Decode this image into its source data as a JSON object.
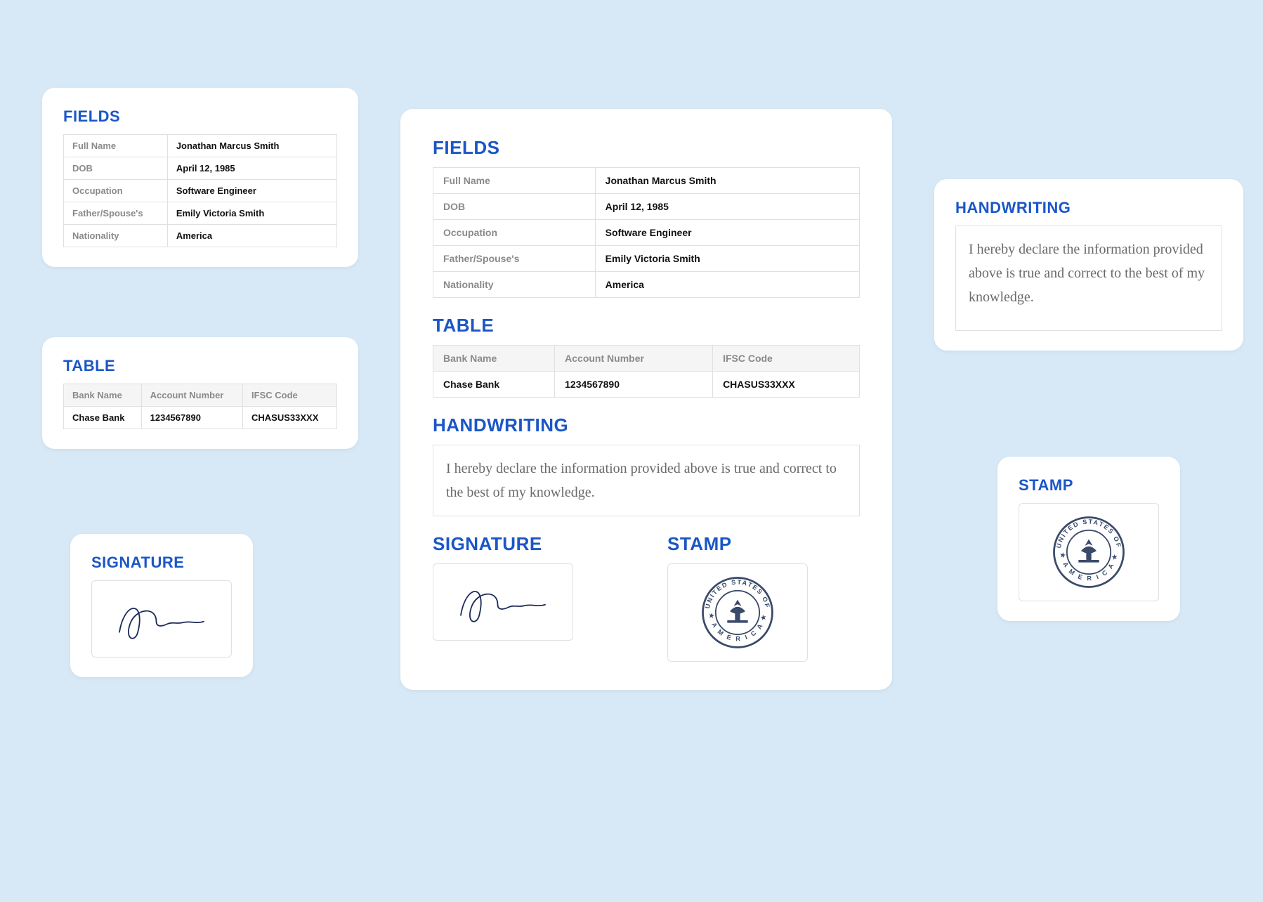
{
  "headings": {
    "fields": "FIELDS",
    "table": "TABLE",
    "handwriting": "HANDWRITING",
    "signature": "SIGNATURE",
    "stamp": "STAMP"
  },
  "fields": {
    "rows": [
      {
        "label": "Full Name",
        "value": "Jonathan Marcus Smith"
      },
      {
        "label": "DOB",
        "value": "April 12, 1985"
      },
      {
        "label": "Occupation",
        "value": "Software Engineer"
      },
      {
        "label": "Father/Spouse's",
        "value": "Emily Victoria Smith"
      },
      {
        "label": "Nationality",
        "value": "America"
      }
    ]
  },
  "table": {
    "headers": [
      "Bank Name",
      "Account Number",
      "IFSC Code"
    ],
    "rows": [
      [
        "Chase Bank",
        "1234567890",
        "CHASUS33XXX"
      ]
    ]
  },
  "handwriting": {
    "text": "I hereby declare the information provided above is true and correct to the best of my knowledge."
  },
  "stamp": {
    "text": "UNITED STATES OF AMERICA"
  }
}
